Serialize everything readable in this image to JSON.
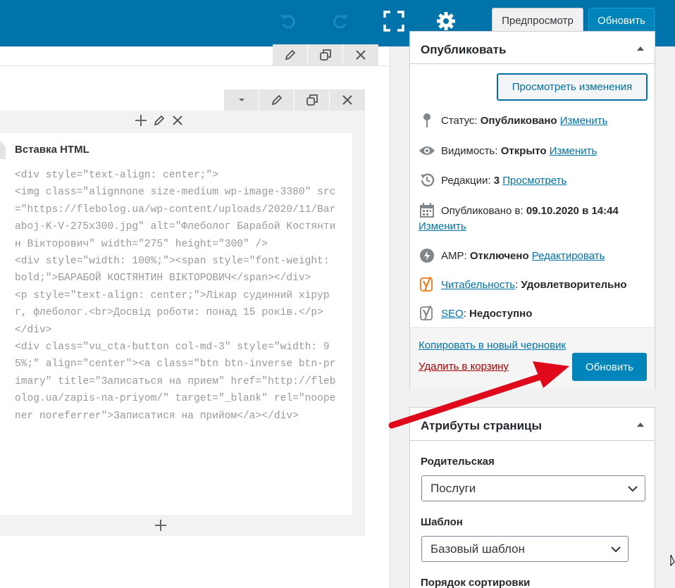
{
  "toolbar": {
    "preview_label": "Предпросмотр",
    "update_label": "Обновить",
    "icons": [
      "undo-icon",
      "redo-icon",
      "fullscreen-icon",
      "gear-icon"
    ]
  },
  "builder": {
    "element_title": "Вставка HTML",
    "code_lines": [
      "<div style=\"text-align: center;\">",
      "<img class=\"alignnone size-medium wp-image-3380\" src=\"https://flebolog.ua/wp-content/uploads/2020/11/Baraboj-K-V-275x300.jpg\" alt=\"Флеболог Барабой Костянтин Вікторович\" width=\"275\" height=\"300\" />",
      "<div style=\"width: 100%;\"><span style=\"font-weight: bold;\">БАРАБОЙ КОСТЯНТИН ВІКТОРОВИЧ</span></div>",
      "<p style=\"text-align: center;\">Лікар судинний хірург, флеболог.<br>Досвід роботи: понад 15 років.</p>",
      "</div>",
      "<div class=\"vu_cta-button col-md-3\" style=\"width: 95%;\" align=\"center\"><a class=\"btn btn-inverse btn-primary\" title=\"Записаться на прием\" href=\"http://flebolog.ua/zapis-na-priyom/\" target=\"_blank\" rel=\"noopener noreferrer\">Записатися на прийом</a></div>"
    ]
  },
  "publish": {
    "title": "Опубликовать",
    "view_changes_label": "Просмотреть изменения",
    "status_label": "Статус:",
    "status_value": "Опубликовано",
    "status_link": "Изменить",
    "visibility_label": "Видимость:",
    "visibility_value": "Открыто",
    "visibility_link": "Изменить",
    "revisions_label": "Редакции:",
    "revisions_value": "3",
    "revisions_link": "Просмотреть",
    "published_label": "Опубликовано в:",
    "published_value": "09.10.2020 в 14:44",
    "published_link": "Изменить",
    "amp_label": "AMP:",
    "amp_value": "Отключено",
    "amp_link": "Редактировать",
    "readability_link": "Читабельность",
    "readability_value": "Удовлетворительно",
    "seo_link": "SEO",
    "seo_value": "Недоступно",
    "copy_link": "Копировать в новый черновик",
    "trash_link": "Удалить в корзину",
    "update_label": "Обновить"
  },
  "attributes": {
    "title": "Атрибуты страницы",
    "parent_label": "Родительская",
    "parent_value": "Послуги",
    "template_label": "Шаблон",
    "template_value": "Базовый шаблон",
    "order_label": "Порядок сортировки"
  },
  "colors": {
    "topbar": "#0073aa",
    "primary_button": "#0085ba",
    "link": "#0073aa",
    "delete_link": "#aa0000",
    "annotation_arrow": "#e0091b",
    "yoast_orange": "#ee7c1b"
  }
}
